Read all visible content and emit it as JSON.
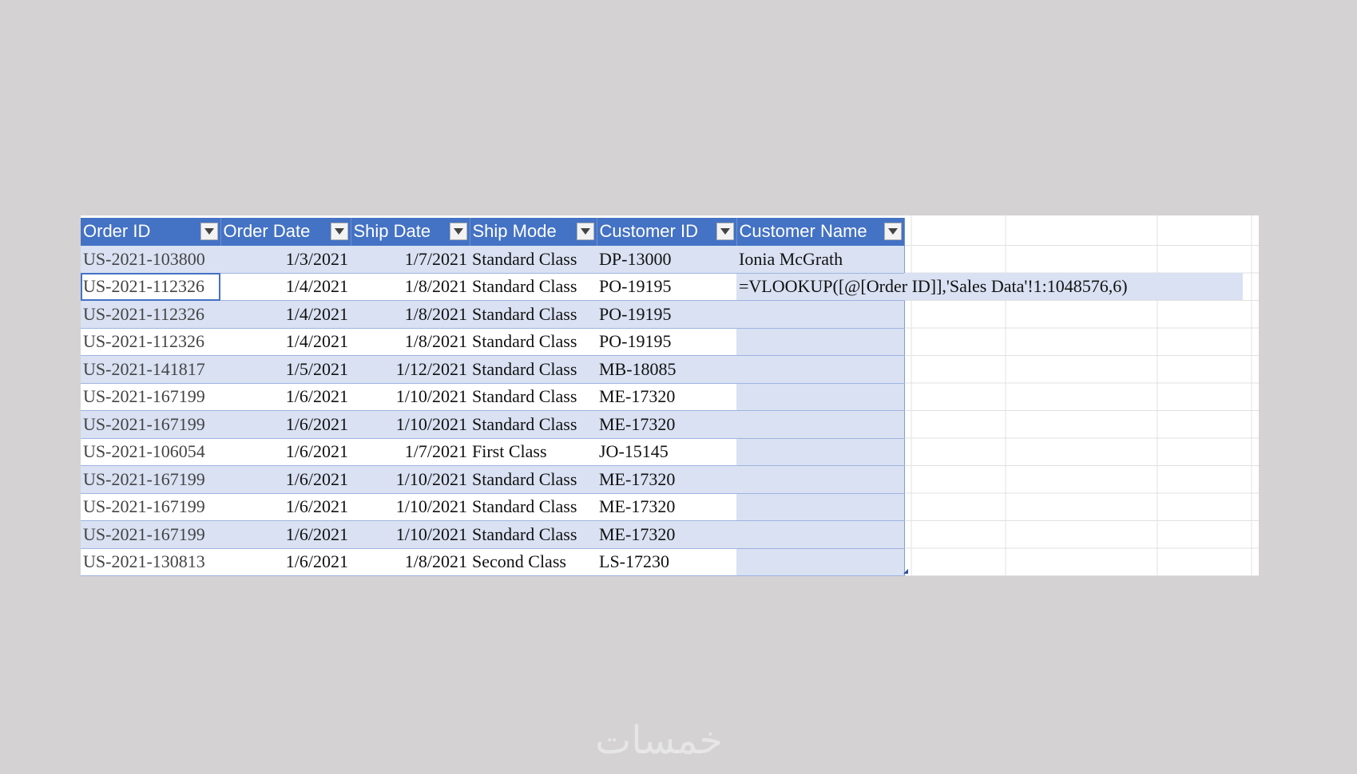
{
  "table": {
    "headers": [
      "Order ID",
      "Order Date",
      "Ship Date",
      "Ship Mode",
      "Customer ID",
      "Customer Name"
    ],
    "rows": [
      {
        "order_id": "US-2021-103800",
        "order_date": "1/3/2021",
        "ship_date": "1/7/2021",
        "ship_mode": "Standard Class",
        "customer_id": "DP-13000",
        "customer_name": "Ionia McGrath"
      },
      {
        "order_id": "US-2021-112326",
        "order_date": "1/4/2021",
        "ship_date": "1/8/2021",
        "ship_mode": "Standard Class",
        "customer_id": "PO-19195",
        "customer_name": "=VLOOKUP([@[Order ID]],'Sales Data'!1:1048576,6)"
      },
      {
        "order_id": "US-2021-112326",
        "order_date": "1/4/2021",
        "ship_date": "1/8/2021",
        "ship_mode": "Standard Class",
        "customer_id": "PO-19195",
        "customer_name": ""
      },
      {
        "order_id": "US-2021-112326",
        "order_date": "1/4/2021",
        "ship_date": "1/8/2021",
        "ship_mode": "Standard Class",
        "customer_id": "PO-19195",
        "customer_name": ""
      },
      {
        "order_id": "US-2021-141817",
        "order_date": "1/5/2021",
        "ship_date": "1/12/2021",
        "ship_mode": "Standard Class",
        "customer_id": "MB-18085",
        "customer_name": ""
      },
      {
        "order_id": "US-2021-167199",
        "order_date": "1/6/2021",
        "ship_date": "1/10/2021",
        "ship_mode": "Standard Class",
        "customer_id": "ME-17320",
        "customer_name": ""
      },
      {
        "order_id": "US-2021-167199",
        "order_date": "1/6/2021",
        "ship_date": "1/10/2021",
        "ship_mode": "Standard Class",
        "customer_id": "ME-17320",
        "customer_name": ""
      },
      {
        "order_id": "US-2021-106054",
        "order_date": "1/6/2021",
        "ship_date": "1/7/2021",
        "ship_mode": "First Class",
        "customer_id": "JO-15145",
        "customer_name": ""
      },
      {
        "order_id": "US-2021-167199",
        "order_date": "1/6/2021",
        "ship_date": "1/10/2021",
        "ship_mode": "Standard Class",
        "customer_id": "ME-17320",
        "customer_name": ""
      },
      {
        "order_id": "US-2021-167199",
        "order_date": "1/6/2021",
        "ship_date": "1/10/2021",
        "ship_mode": "Standard Class",
        "customer_id": "ME-17320",
        "customer_name": ""
      },
      {
        "order_id": "US-2021-167199",
        "order_date": "1/6/2021",
        "ship_date": "1/10/2021",
        "ship_mode": "Standard Class",
        "customer_id": "ME-17320",
        "customer_name": ""
      },
      {
        "order_id": "US-2021-130813",
        "order_date": "1/6/2021",
        "ship_date": "1/8/2021",
        "ship_mode": "Second Class",
        "customer_id": "LS-17230",
        "customer_name": ""
      }
    ]
  },
  "watermark": "خمسات",
  "colors": {
    "header_bg": "#4472c4",
    "band_bg": "#d9e1f2",
    "page_bg": "#d4d2d3"
  },
  "icons": {
    "filter": "filter-dropdown-icon"
  }
}
